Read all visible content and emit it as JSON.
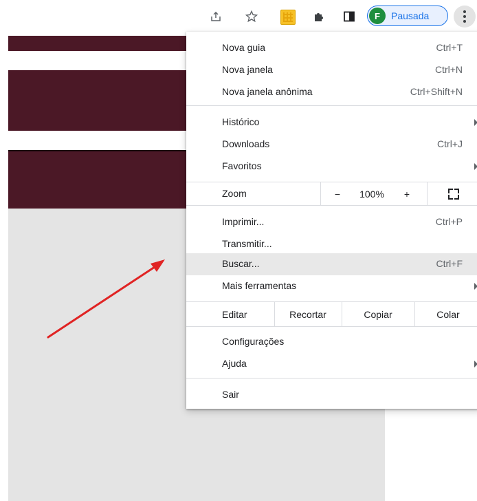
{
  "toolbar": {
    "share_icon": "share-icon",
    "star_icon": "bookmark-star-icon",
    "extension_icon": "yellow-extension-icon",
    "puzzle_icon": "extensions-puzzle-icon",
    "sidepanel_icon": "side-panel-icon",
    "profile": {
      "initial": "F",
      "label": "Pausada"
    },
    "menu_icon": "vertical-dots-icon"
  },
  "menu": {
    "group1": [
      {
        "label": "Nova guia",
        "shortcut": "Ctrl+T"
      },
      {
        "label": "Nova janela",
        "shortcut": "Ctrl+N"
      },
      {
        "label": "Nova janela anônima",
        "shortcut": "Ctrl+Shift+N"
      }
    ],
    "group2": [
      {
        "label": "Histórico",
        "shortcut": ""
      },
      {
        "label": "Downloads",
        "shortcut": "Ctrl+J"
      },
      {
        "label": "Favoritos",
        "shortcut": ""
      }
    ],
    "zoom": {
      "label": "Zoom",
      "minus": "−",
      "value": "100%",
      "plus": "+"
    },
    "group3": [
      {
        "label": "Imprimir...",
        "shortcut": "Ctrl+P"
      },
      {
        "label": "Transmitir...",
        "shortcut": ""
      },
      {
        "label": "Buscar...",
        "shortcut": "Ctrl+F"
      },
      {
        "label": "Mais ferramentas",
        "shortcut": ""
      }
    ],
    "edit": {
      "label": "Editar",
      "cut": "Recortar",
      "copy": "Copiar",
      "paste": "Colar"
    },
    "group4": [
      {
        "label": "Configurações"
      },
      {
        "label": "Ajuda"
      }
    ],
    "exit": {
      "label": "Sair"
    }
  },
  "colors": {
    "band": "#4b1826",
    "highlight": "#e8e8e8",
    "arrow": "#e02424",
    "profile_accent": "#1a73e8",
    "avatar": "#1e8e3e"
  }
}
